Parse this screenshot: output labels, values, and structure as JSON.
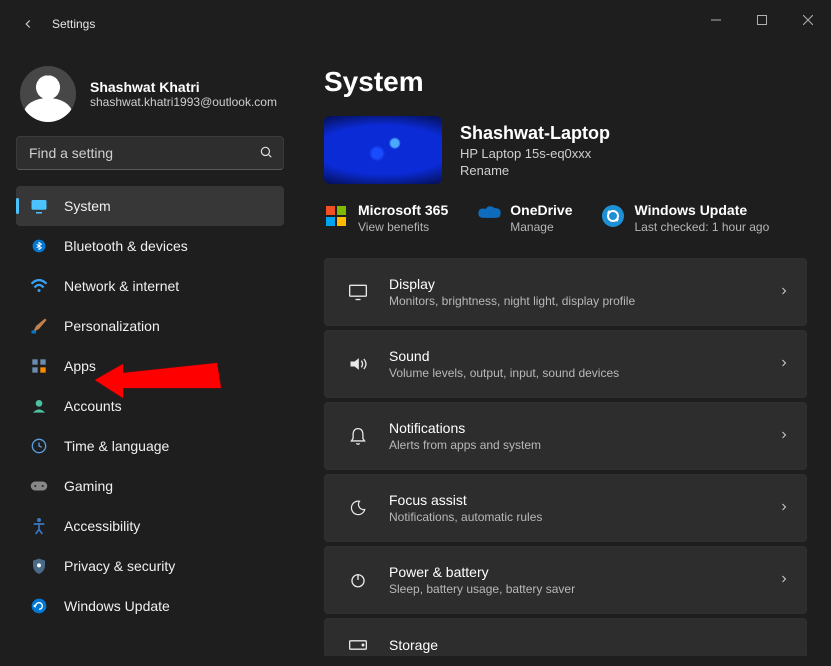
{
  "app_title": "Settings",
  "page_title": "System",
  "profile": {
    "name": "Shashwat Khatri",
    "email": "shashwat.khatri1993@outlook.com"
  },
  "search": {
    "placeholder": "Find a setting"
  },
  "sidebar": {
    "items": [
      {
        "id": "system",
        "label": "System",
        "icon": "monitor",
        "active": true
      },
      {
        "id": "bluetooth",
        "label": "Bluetooth & devices",
        "icon": "bt",
        "active": false
      },
      {
        "id": "network",
        "label": "Network & internet",
        "icon": "wifi",
        "active": false
      },
      {
        "id": "personalization",
        "label": "Personalization",
        "icon": "brush",
        "active": false
      },
      {
        "id": "apps",
        "label": "Apps",
        "icon": "grid",
        "active": false
      },
      {
        "id": "accounts",
        "label": "Accounts",
        "icon": "person",
        "active": false
      },
      {
        "id": "time",
        "label": "Time & language",
        "icon": "clock",
        "active": false
      },
      {
        "id": "gaming",
        "label": "Gaming",
        "icon": "gamepad",
        "active": false
      },
      {
        "id": "accessibility",
        "label": "Accessibility",
        "icon": "access",
        "active": false
      },
      {
        "id": "privacy",
        "label": "Privacy & security",
        "icon": "shield",
        "active": false
      },
      {
        "id": "update",
        "label": "Windows Update",
        "icon": "sync",
        "active": false
      }
    ]
  },
  "device": {
    "name": "Shashwat-Laptop",
    "model": "HP Laptop 15s-eq0xxx",
    "rename": "Rename"
  },
  "services": [
    {
      "id": "m365",
      "title": "Microsoft 365",
      "sub": "View benefits"
    },
    {
      "id": "onedrive",
      "title": "OneDrive",
      "sub": "Manage"
    },
    {
      "id": "update",
      "title": "Windows Update",
      "sub": "Last checked: 1 hour ago"
    }
  ],
  "cards": [
    {
      "id": "display",
      "title": "Display",
      "desc": "Monitors, brightness, night light, display profile",
      "icon": "monitor"
    },
    {
      "id": "sound",
      "title": "Sound",
      "desc": "Volume levels, output, input, sound devices",
      "icon": "sound"
    },
    {
      "id": "notifications",
      "title": "Notifications",
      "desc": "Alerts from apps and system",
      "icon": "bell"
    },
    {
      "id": "focus",
      "title": "Focus assist",
      "desc": "Notifications, automatic rules",
      "icon": "moon"
    },
    {
      "id": "power",
      "title": "Power & battery",
      "desc": "Sleep, battery usage, battery saver",
      "icon": "power"
    },
    {
      "id": "storage",
      "title": "Storage",
      "desc": "",
      "icon": "drive"
    }
  ]
}
